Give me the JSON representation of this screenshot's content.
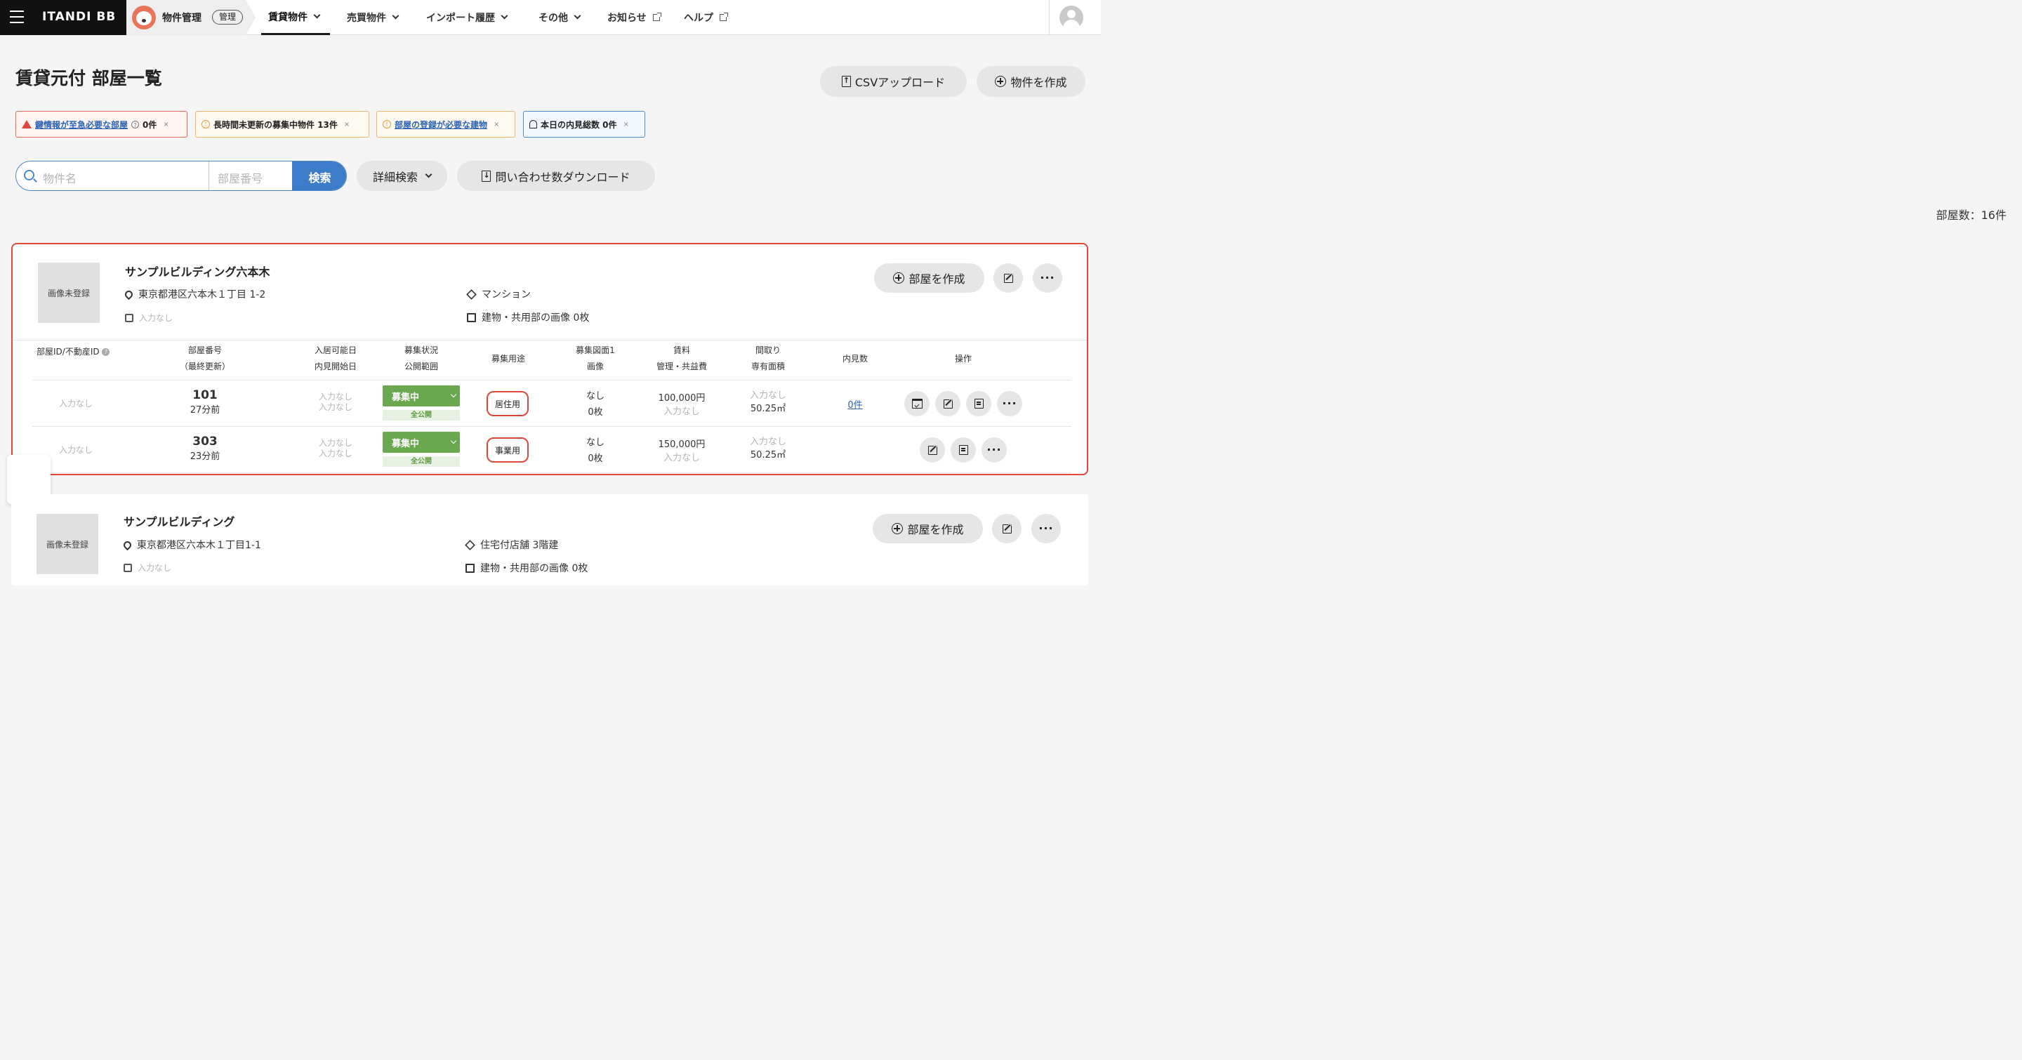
{
  "header": {
    "logo": "ITANDI BB",
    "app_name": "物件管理",
    "app_tag": "管理",
    "nav": [
      "賃貸物件",
      "売買物件",
      "インポート履歴",
      "その他",
      "お知らせ",
      "ヘルプ"
    ]
  },
  "page": {
    "title": "賃貸元付 部屋一覧",
    "csv_upload": "CSVアップロード",
    "create_property": "物件を作成",
    "room_count": "部屋数：16件"
  },
  "alerts": [
    {
      "label": "鍵情報が至急必要な部屋",
      "count": "0件"
    },
    {
      "label": "長時間未更新の募集中物件 13件"
    },
    {
      "label": "部屋の登録が必要な建物"
    },
    {
      "label": "本日の内見総数 0件"
    }
  ],
  "search": {
    "name_placeholder": "物件名",
    "room_placeholder": "部屋番号",
    "submit": "検索",
    "advanced": "詳細検索",
    "download": "問い合わせ数ダウンロード"
  },
  "table_headers": {
    "room_id": "部屋ID/不動産ID",
    "room_no": "部屋番号",
    "room_no_sub": "（最終更新）",
    "move_in": "入居可能日",
    "viewing_start": "内見開始日",
    "status": "募集状況",
    "public_scope": "公開範囲",
    "usage": "募集用途",
    "floorplan": "募集図面1",
    "image": "画像",
    "rent": "賃料",
    "fee": "管理・共益費",
    "layout": "間取り",
    "area": "専有面積",
    "viewings": "内見数",
    "actions": "操作"
  },
  "buildings": [
    {
      "thumb": "画像未登録",
      "name": "サンプルビルディング六本木",
      "address": "東京都港区六本木１丁目 1-2",
      "station": "入力なし",
      "type": "マンション",
      "images": "建物・共用部の画像 0枚",
      "create_room": "部屋を作成",
      "rooms": [
        {
          "id": "入力なし",
          "no": "101",
          "updated": "27分前",
          "move_in": "入力なし",
          "viewing": "入力なし",
          "status": "募集中",
          "scope": "全公開",
          "usage": "居住用",
          "floorplan": "なし",
          "images": "0枚",
          "rent": "100,000円",
          "fee": "入力なし",
          "layout": "入力なし",
          "area": "50.25㎡",
          "viewings": "0件"
        },
        {
          "id": "入力なし",
          "no": "303",
          "updated": "23分前",
          "move_in": "入力なし",
          "viewing": "入力なし",
          "status": "募集中",
          "scope": "全公開",
          "usage": "事業用",
          "floorplan": "なし",
          "images": "0枚",
          "rent": "150,000円",
          "fee": "入力なし",
          "layout": "入力なし",
          "area": "50.25㎡"
        }
      ]
    },
    {
      "thumb": "画像未登録",
      "name": "サンプルビルディング",
      "address": "東京都港区六本木１丁目1-1",
      "station": "入力なし",
      "type": "住宅付店舗 3階建",
      "images": "建物・共用部の画像 0枚",
      "create_room": "部屋を作成"
    }
  ]
}
